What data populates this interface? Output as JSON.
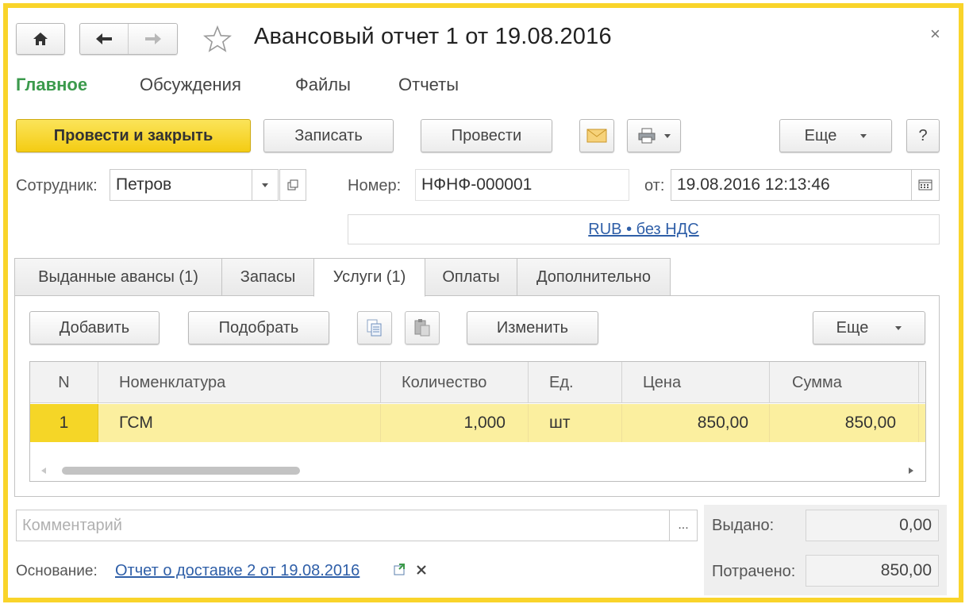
{
  "window": {
    "title": "Авансовый отчет 1 от 19.08.2016",
    "close_glyph": "×"
  },
  "menu": {
    "items": [
      {
        "label": "Главное",
        "active": true
      },
      {
        "label": "Обсуждения"
      },
      {
        "label": "Файлы"
      },
      {
        "label": "Отчеты"
      }
    ]
  },
  "toolbar": {
    "post_close_label": "Провести и закрыть",
    "save_label": "Записать",
    "post_label": "Провести",
    "more_label": "Еще",
    "help_label": "?"
  },
  "form": {
    "employee_label": "Сотрудник:",
    "employee_value": "Петров",
    "number_label": "Номер:",
    "number_value": "НФНФ-000001",
    "date_label": "от:",
    "date_value": "19.08.2016 12:13:46",
    "currency_link": "RUB • без НДС"
  },
  "tabs": [
    {
      "label": "Выданные авансы (1)"
    },
    {
      "label": "Запасы"
    },
    {
      "label": "Услуги (1)",
      "active": true
    },
    {
      "label": "Оплаты"
    },
    {
      "label": "Дополнительно"
    }
  ],
  "tab_toolbar": {
    "add_label": "Добавить",
    "pick_label": "Подобрать",
    "change_label": "Изменить",
    "more_label": "Еще"
  },
  "table": {
    "columns": [
      "N",
      "Номенклатура",
      "Количество",
      "Ед.",
      "Цена",
      "Сумма"
    ],
    "rows": [
      [
        "1",
        "ГСМ",
        "1,000",
        "шт",
        "850,00",
        "850,00"
      ]
    ],
    "scroll_position": 0.0
  },
  "footer": {
    "comment_placeholder": "Комментарий",
    "comment_btn": "...",
    "basis_label": "Основание:",
    "basis_link": "Отчет о доставке 2 от 19.08.2016",
    "issued_label": "Выдано:",
    "issued_value": "0,00",
    "spent_label": "Потрачено:",
    "spent_value": "850,00"
  },
  "colors": {
    "accent_frame": "#f9d42a",
    "primary_button": "#f4cc13",
    "active_menu": "#3b9a4c",
    "selected_row": "#fbef9f",
    "link": "#2f5fa8"
  }
}
